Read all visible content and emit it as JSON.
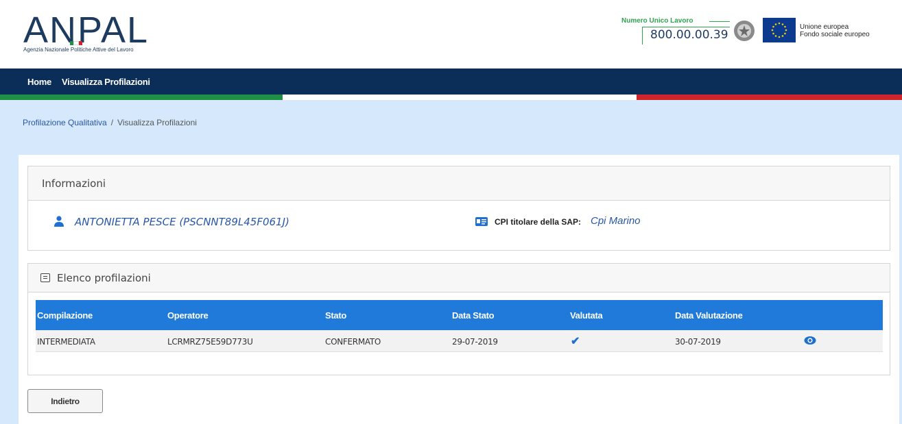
{
  "header": {
    "logo_text": "ANPAL",
    "logo_subtitle": "Agenzia Nazionale Politiche Attive del Lavoro",
    "contact_label": "Numero Unico Lavoro",
    "contact_number": "800.00.00.39",
    "eu_line1": "Unione europea",
    "eu_line2": "Fondo sociale europeo"
  },
  "nav": {
    "items": [
      {
        "label": "Home"
      },
      {
        "label": "Visualizza Profilazioni"
      }
    ]
  },
  "breadcrumb": {
    "parent": "Profilazione Qualitativa",
    "separator": "/",
    "current": "Visualizza Profilazioni"
  },
  "info_panel": {
    "title": "Informazioni",
    "user_name": "ANTONIETTA PESCE (PSCNNT89L45F061J)",
    "cpi_label": "CPI titolare della SAP:",
    "cpi_value": "Cpi Marino"
  },
  "list_panel": {
    "title": "Elenco profilazioni",
    "columns": [
      "Compilazione",
      "Operatore",
      "Stato",
      "Data Stato",
      "Valutata",
      "Data Valutazione"
    ],
    "rows": [
      {
        "compilazione": "INTERMEDIATA",
        "operatore": "LCRMRZ75E59D773U",
        "stato": "CONFERMATO",
        "data_stato": "29-07-2019",
        "valutata_icon": "check-icon",
        "data_valutazione": "30-07-2019",
        "action_icon": "eye-icon"
      }
    ]
  },
  "buttons": {
    "back_label": "Indietro"
  },
  "colors": {
    "navbar": "#0b2e59",
    "table_header": "#1f7ad9",
    "page_background": "#d6e8fb",
    "link_blue": "#2757a6",
    "green": "#1f8f45",
    "red": "#d0242c"
  }
}
